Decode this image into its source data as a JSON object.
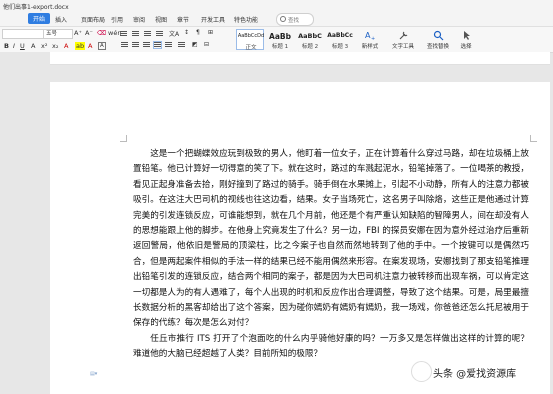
{
  "window": {
    "title": "他们出事1-export.docx"
  },
  "menu": {
    "start": "开始",
    "tabs": [
      "插入",
      "页面布局",
      "引用",
      "审阅",
      "视图",
      "章节",
      "开发工具",
      "特色功能"
    ],
    "search_label": "查找"
  },
  "ribbon": {
    "font_name": "",
    "font_size": "五号",
    "styles": [
      {
        "sample": "AaBbCcDd",
        "label": "正文"
      },
      {
        "sample": "AaBb",
        "label": "标题 1"
      },
      {
        "sample": "AaBbC",
        "label": "标题 2"
      },
      {
        "sample": "AaBbCc",
        "label": "标题 3"
      }
    ],
    "new_style": "新样式",
    "text_tools": "文字工具",
    "find_replace": "查找替换",
    "select": "选择"
  },
  "document": {
    "paragraphs": [
      "这是一个把蝴蝶效应玩到极致的男人，他盯着一位女子，正在计算着什么穿过马路，却在垃圾桶上放置铅笔。他已计算好一切得意的笑了下。就在这时，路过的车溅起泥水，铅笔掉落了。一位喝茶的教授，看见正起身准备去拾，刚好撞到了路过的骑手。骑手倒在水果摊上，引起不小动静，所有人的注意力都被吸引。在这注大巴司机的视线也往这边看，结果。女子当场死亡，这名男子叫除烙，这些正是他通过计算完美的引发连锁反应，可谁能想到，就在几个月前，他还是个有严重认知缺陷的智障男人，间在却没有人的思想能跟上他的脚步。在他身上究竟发生了什么？另一边，FBI 的探员安娜在因为意外经过治疗后重新返回警局，他依旧是警局的顶梁柱，比之今案子也自然而然地转到了他的手中。一个按键可以是偶然巧合，但是两起案件相似的手法一样的结果已经不能用偶然来形容。在案发现场，安娜找到了那支铅笔推理出铅笔引发的连锁反应，结合两个相同的案子，都是因为大巴司机注意力被转移而出现车祸，可以肯定这一切都是人为的有人遇难了，每个人出现的时机和反应作出合理调整，导致了这个结果。可是，局里最擅长数据分析的黑客却给出了这个答案，因为碰你嫣奶有嫣奶有嫣奶，我一场戏，你爸爸还怎么托尼被用于保存的代练？每次是怎么对付？",
      "任丘市推行 ITS 打开了个泡面吃的什么内乎骑他好康的吗？一万多又是怎样做出这样的计算的呢？难道他的大脑已经超越了人类？目前所知的极限？"
    ]
  },
  "watermark": {
    "text": "头条 @爱找资源库"
  }
}
